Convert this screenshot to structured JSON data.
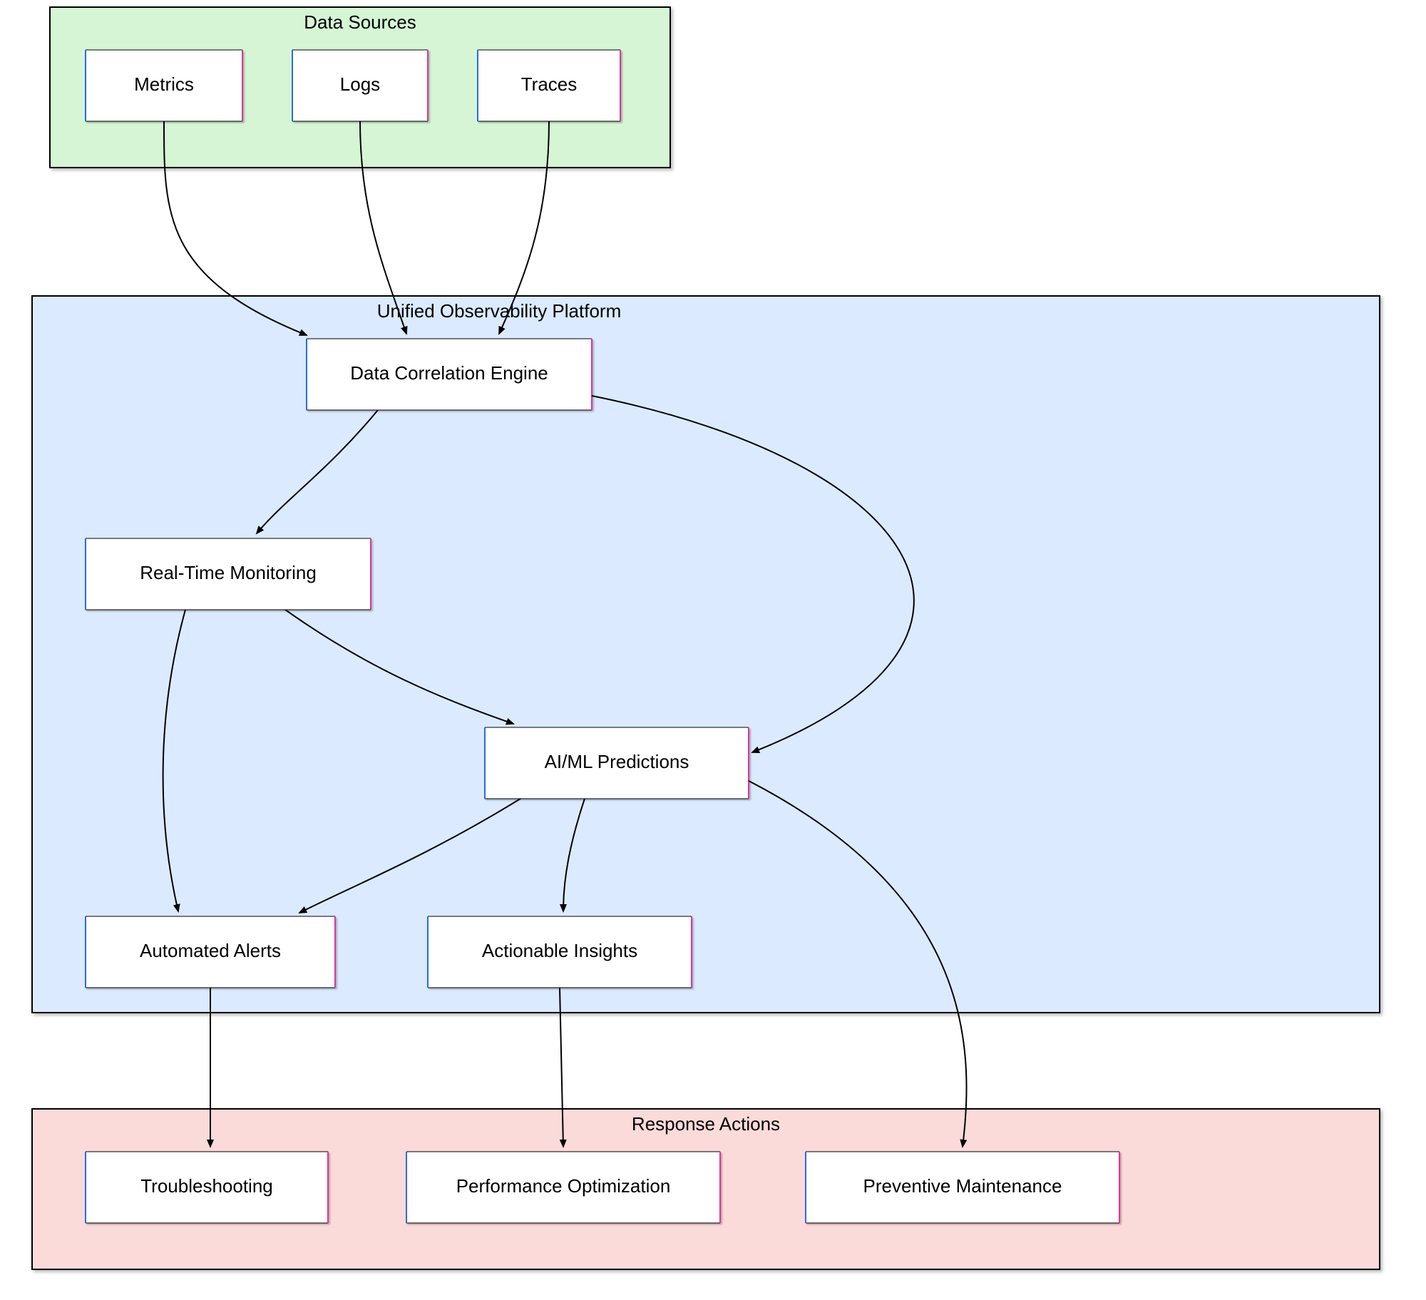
{
  "groups": {
    "data_sources": {
      "title": "Data Sources"
    },
    "platform": {
      "title": "Unified Observability Platform"
    },
    "response": {
      "title": "Response Actions"
    }
  },
  "nodes": {
    "metrics": {
      "label": "Metrics"
    },
    "logs": {
      "label": "Logs"
    },
    "traces": {
      "label": "Traces"
    },
    "correlation": {
      "label": "Data Correlation Engine"
    },
    "monitoring": {
      "label": "Real-Time Monitoring"
    },
    "aiml": {
      "label": "AI/ML Predictions"
    },
    "alerts": {
      "label": "Automated Alerts"
    },
    "insights": {
      "label": "Actionable Insights"
    },
    "troubleshoot": {
      "label": "Troubleshooting"
    },
    "perfopt": {
      "label": "Performance Optimization"
    },
    "preventive": {
      "label": "Preventive Maintenance"
    }
  }
}
